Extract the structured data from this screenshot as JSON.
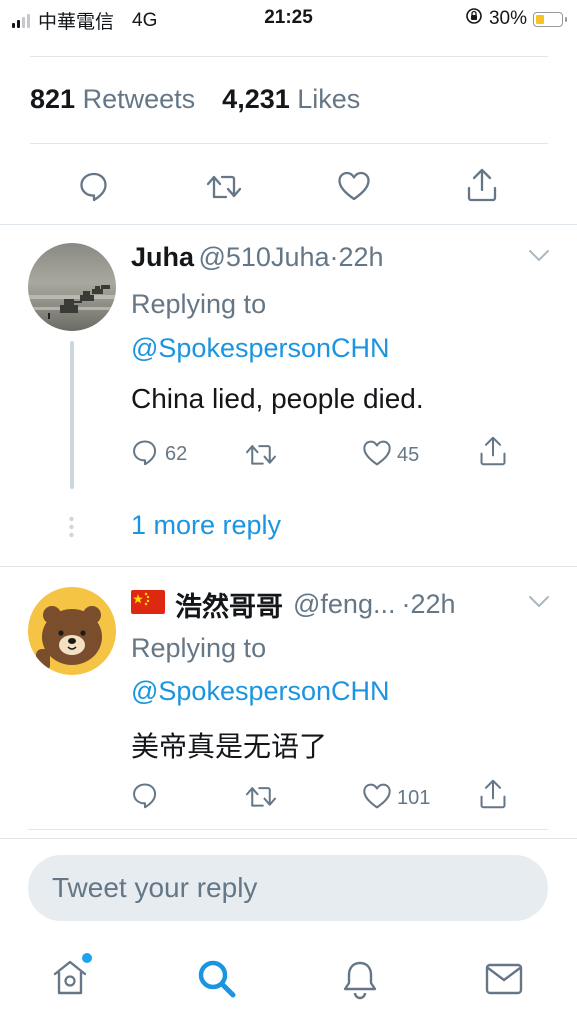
{
  "status_bar": {
    "carrier": "中華電信",
    "network": "4G",
    "time": "21:25",
    "battery": "30%",
    "battery_level": 0.3
  },
  "tweet_stats": {
    "retweets_count": "821",
    "retweets_label": "Retweets",
    "likes_count": "4,231",
    "likes_label": "Likes"
  },
  "replies": [
    {
      "name": "Juha",
      "handle": "@510Juha",
      "time": "·22h",
      "replying_label": "Replying to",
      "replying_to": "@SpokespersonCHN",
      "text": "China lied, people died.",
      "reply_count": "62",
      "like_count": "45"
    },
    {
      "name": "浩然哥哥",
      "handle": "@feng...",
      "time": "·22h",
      "replying_label": "Replying to",
      "replying_to": "@SpokespersonCHN",
      "text": "美帝真是无语了",
      "reply_count": "",
      "like_count": "101"
    }
  ],
  "more_replies_link": "1 more reply",
  "reply_input": {
    "placeholder": "Tweet your reply"
  },
  "colors": {
    "accent": "#1b95e0",
    "secondary_text": "#657786",
    "divider": "#e1e8ed",
    "notification_dot": "#1da1f2"
  },
  "icons": [
    "reply-icon",
    "retweet-icon",
    "like-icon",
    "share-icon",
    "chevron-down-icon",
    "home-icon",
    "search-icon",
    "notifications-icon",
    "messages-icon",
    "flag-icon"
  ]
}
